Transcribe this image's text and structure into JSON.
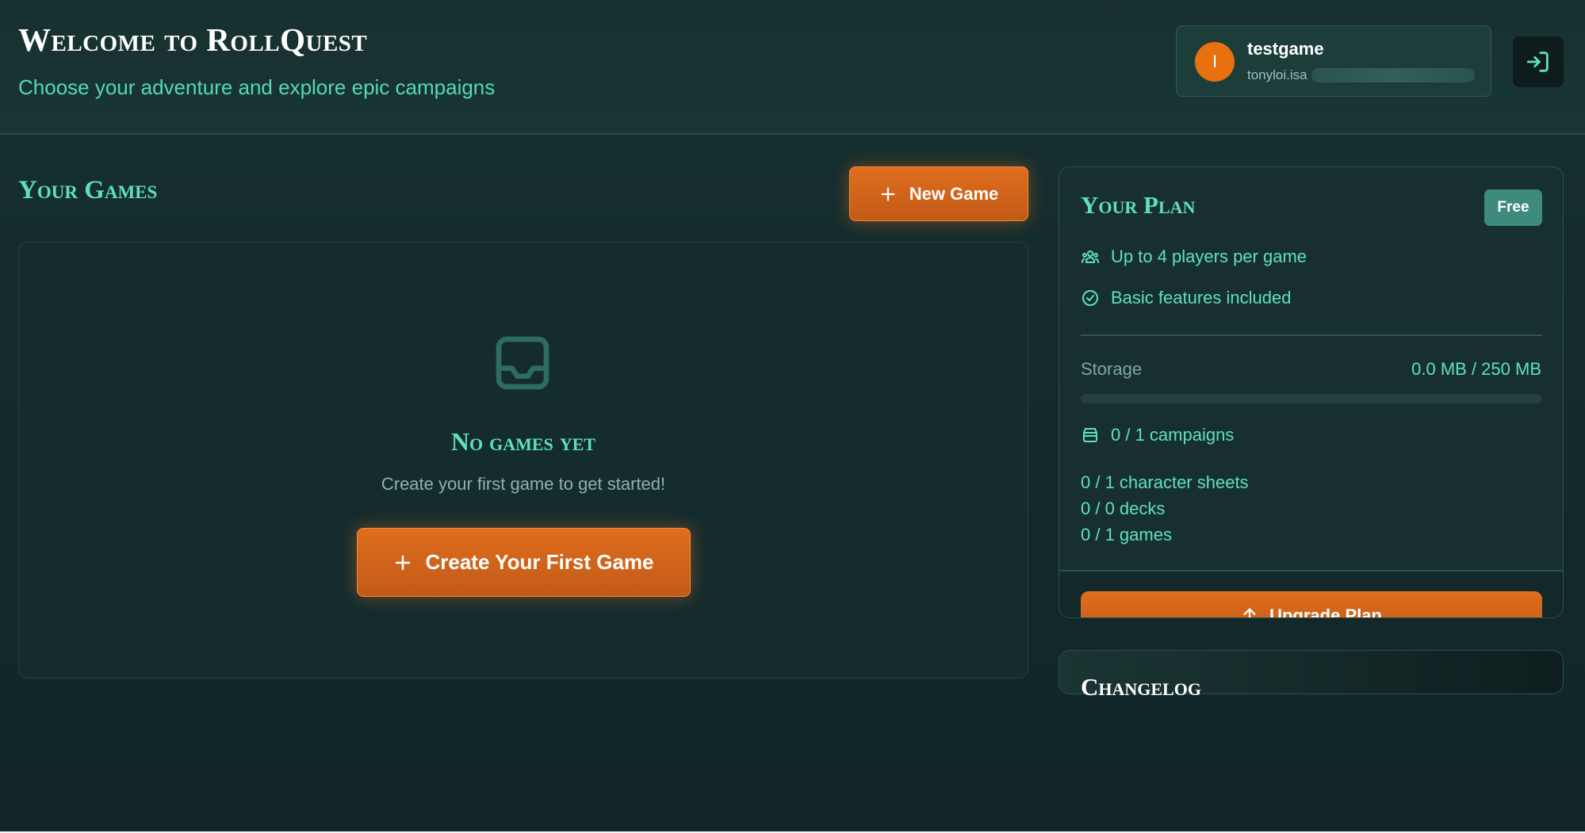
{
  "header": {
    "title": "Welcome to RollQuest",
    "subtitle": "Choose your adventure and explore epic campaigns"
  },
  "user": {
    "avatar_initial": "I",
    "name": "testgame",
    "email_visible": "tonyloi.isa",
    "logout_icon": "logout-icon"
  },
  "games": {
    "title": "Your Games",
    "new_game_label": "New Game",
    "empty_icon": "inbox-icon",
    "empty_title": "No games yet",
    "empty_text": "Create your first game to get started!",
    "create_first_label": "Create Your First Game"
  },
  "plan": {
    "title": "Your Plan",
    "badge": "Free",
    "features": [
      {
        "icon": "users-icon",
        "label": "Up to 4 players per game"
      },
      {
        "icon": "check-circle-icon",
        "label": "Basic features included"
      }
    ],
    "storage_label": "Storage",
    "storage_value": "0.0 MB / 250 MB",
    "storage_fraction": 0,
    "campaigns": "0 / 1 campaigns",
    "character_sheets": "0 / 1 character sheets",
    "decks": "0 / 0 decks",
    "games": "0 / 1 games",
    "upgrade_label": "Upgrade Plan"
  },
  "changelog": {
    "title": "Changelog"
  },
  "colors": {
    "background": "#132b2e",
    "accent": "#5fe0bd",
    "primary_button": "#d8661b",
    "badge": "#3e8b7d"
  }
}
